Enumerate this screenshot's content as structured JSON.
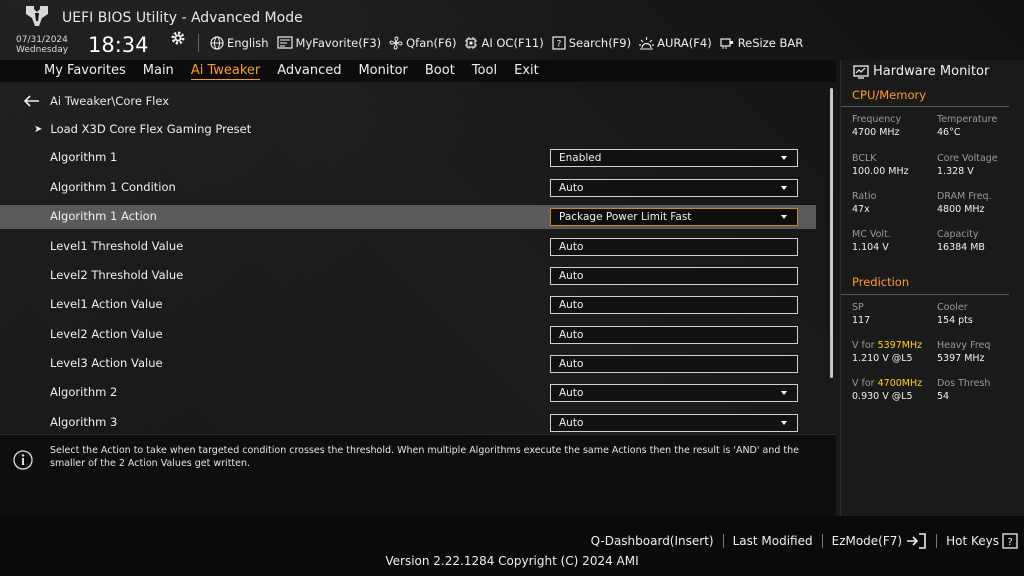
{
  "header": {
    "app_title": "UEFI BIOS Utility - Advanced Mode",
    "date": "07/31/2024",
    "weekday": "Wednesday",
    "time": "18:34",
    "toolbar": [
      {
        "icon": "globe-icon",
        "label": "English"
      },
      {
        "icon": "my-favorite-icon",
        "label": "MyFavorite(F3)"
      },
      {
        "icon": "fan-icon",
        "label": "Qfan(F6)"
      },
      {
        "icon": "ai-oc-icon",
        "label": "AI OC(F11)"
      },
      {
        "icon": "search-icon",
        "label": "Search(F9)"
      },
      {
        "icon": "aura-icon",
        "label": "AURA(F4)"
      },
      {
        "icon": "resize-bar-icon",
        "label": "ReSize BAR"
      }
    ]
  },
  "menu": {
    "items": [
      "My Favorites",
      "Main",
      "Ai Tweaker",
      "Advanced",
      "Monitor",
      "Boot",
      "Tool",
      "Exit"
    ],
    "active": "Ai Tweaker"
  },
  "main": {
    "breadcrumb": "Ai Tweaker\\Core Flex",
    "preset_label": "Load X3D Core Flex Gaming Preset",
    "rows": [
      {
        "label": "Algorithm 1",
        "value": "Enabled",
        "dropdown": true
      },
      {
        "label": "Algorithm 1 Condition",
        "value": "Auto",
        "dropdown": true
      },
      {
        "label": "Algorithm 1 Action",
        "value": "Package Power Limit Fast",
        "dropdown": true,
        "selected": true
      },
      {
        "label": "Level1 Threshold Value",
        "value": "Auto",
        "dropdown": false
      },
      {
        "label": "Level2 Threshold Value",
        "value": "Auto",
        "dropdown": false
      },
      {
        "label": "Level1 Action Value",
        "value": "Auto",
        "dropdown": false
      },
      {
        "label": "Level2 Action Value",
        "value": "Auto",
        "dropdown": false
      },
      {
        "label": "Level3 Action Value",
        "value": "Auto",
        "dropdown": false
      },
      {
        "label": "Algorithm 2",
        "value": "Auto",
        "dropdown": true
      },
      {
        "label": "Algorithm 3",
        "value": "Auto",
        "dropdown": true
      }
    ]
  },
  "help": {
    "text": "Select the Action to take when targeted condition crosses the threshold. When multiple Algorithms execute the same Actions then the result is 'AND' and the smaller of the 2 Action Values get written."
  },
  "hardware_monitor": {
    "title": "Hardware Monitor",
    "cpu_memory": {
      "section": "CPU/Memory",
      "frequency_label": "Frequency",
      "frequency": "4700 MHz",
      "temperature_label": "Temperature",
      "temperature": "46°C",
      "bclk_label": "BCLK",
      "bclk": "100.00 MHz",
      "core_voltage_label": "Core Voltage",
      "core_voltage": "1.328 V",
      "ratio_label": "Ratio",
      "ratio": "47x",
      "dram_freq_label": "DRAM Freq.",
      "dram_freq": "4800 MHz",
      "mc_volt_label": "MC Volt.",
      "mc_volt": "1.104 V",
      "capacity_label": "Capacity",
      "capacity": "16384 MB"
    },
    "prediction": {
      "section": "Prediction",
      "sp_label": "SP",
      "sp": "117",
      "cooler_label": "Cooler",
      "cooler": "154 pts",
      "v_for_prefix": "V for ",
      "v_for_1_freq": "5397MHz",
      "v_for_1": "1.210 V @L5",
      "heavy_freq_label": "Heavy Freq",
      "heavy_freq": "5397 MHz",
      "v_for_2_freq": "4700MHz",
      "v_for_2": "0.930 V @L5",
      "dos_thresh_label": "Dos Thresh",
      "dos_thresh": "54"
    }
  },
  "footer": {
    "q_dashboard": "Q-Dashboard(Insert)",
    "last_modified": "Last Modified",
    "ezmode": "EzMode(F7)",
    "hot_keys": "Hot Keys",
    "version": "Version 2.22.1284 Copyright (C) 2024 AMI"
  },
  "colors": {
    "accent": "#ff9b2e",
    "highlight": "#ffd21a",
    "selected_row": "#5a5a5a"
  }
}
